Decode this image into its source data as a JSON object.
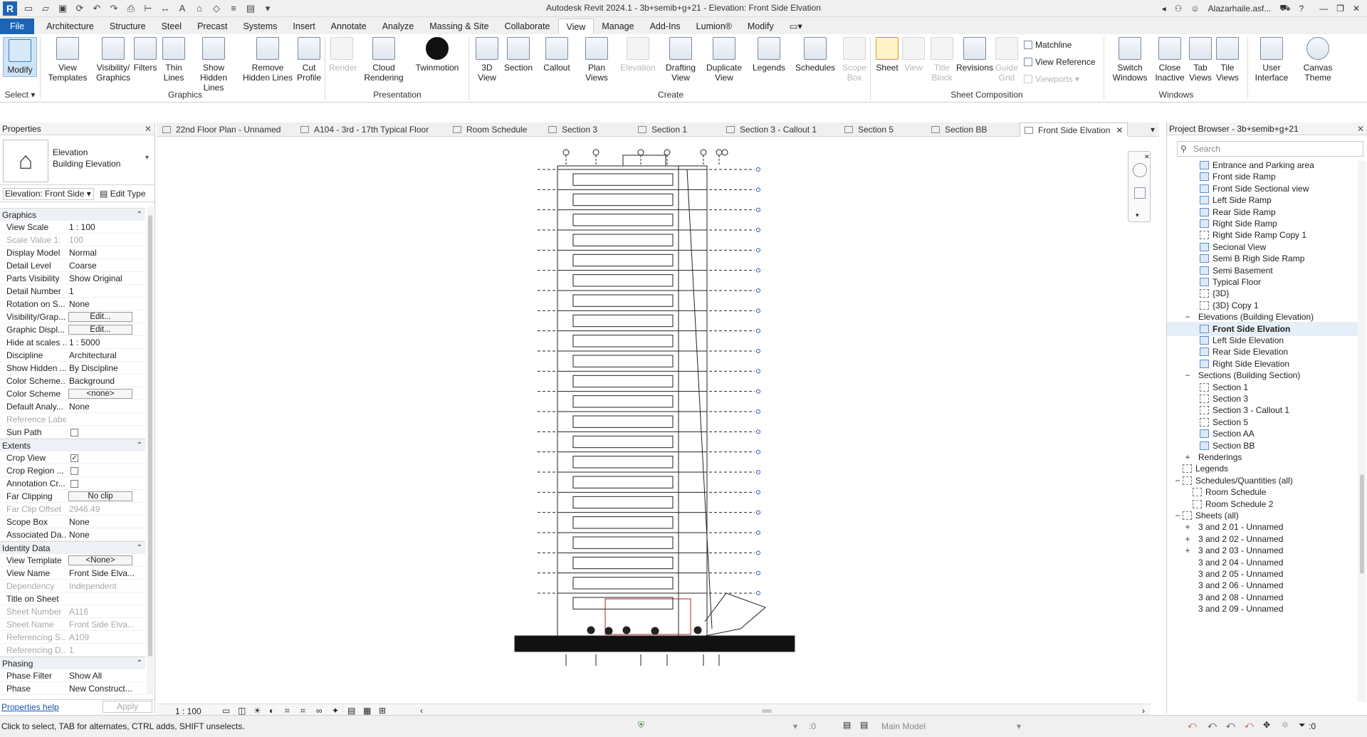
{
  "app": {
    "title": "Autodesk Revit 2024.1 - 3b+semib+g+21 - Elevation: Front Side Elvation",
    "user": "Alazarhaile.asf..."
  },
  "ribbon_tabs": [
    "File",
    "Architecture",
    "Structure",
    "Steel",
    "Precast",
    "Systems",
    "Insert",
    "Annotate",
    "Analyze",
    "Massing & Site",
    "Collaborate",
    "View",
    "Manage",
    "Add-Ins",
    "Lumion®",
    "Modify"
  ],
  "ribbon": {
    "select": {
      "modify": "Modify",
      "label": "Select"
    },
    "graphics": {
      "label": "Graphics",
      "view_templates": "View Templates",
      "visibility_graphics": "Visibility/ Graphics",
      "filters": "Filters",
      "thin_lines": "Thin Lines",
      "show_hidden_lines": "Show Hidden Lines",
      "remove_hidden_lines": "Remove Hidden Lines",
      "cut_profile": "Cut Profile"
    },
    "presentation": {
      "label": "Presentation",
      "render": "Render",
      "cloud_rendering": "Cloud Rendering",
      "twinmotion": "Twinmotion"
    },
    "create": {
      "label": "Create",
      "view_3d": "3D View",
      "section": "Section",
      "callout": "Callout",
      "plan_views": "Plan Views",
      "elevation": "Elevation",
      "drafting_view": "Drafting View",
      "duplicate_view": "Duplicate View",
      "legends": "Legends",
      "schedules": "Schedules",
      "scope_box": "Scope Box"
    },
    "sheet_composition": {
      "label": "Sheet Composition",
      "sheet": "Sheet",
      "view": "View",
      "title_block": "Title Block",
      "revisions": "Revisions",
      "guide_grid": "Guide Grid",
      "matchline": "Matchline",
      "view_reference": "View Reference",
      "viewports": "Viewports"
    },
    "windows": {
      "label": "Windows",
      "switch_windows": "Switch Windows",
      "close_inactive": "Close Inactive",
      "tab_views": "Tab Views",
      "tile_views": "Tile Views"
    },
    "ui": {
      "user_interface": "User Interface",
      "canvas_theme": "Canvas Theme"
    }
  },
  "properties": {
    "title": "Properties",
    "type_line1": "Elevation",
    "type_line2": "Building Elevation",
    "instance": "Elevation: Front Side",
    "edit_type": "Edit Type",
    "help": "Properties help",
    "apply": "Apply",
    "sections": {
      "graphics": "Graphics",
      "extents": "Extents",
      "identity": "Identity Data",
      "phasing": "Phasing"
    },
    "graphics_rows": [
      {
        "name": "View Scale",
        "value": "1 : 100"
      },
      {
        "name": "Scale Value    1:",
        "value": "100",
        "grey": true
      },
      {
        "name": "Display Model",
        "value": "Normal"
      },
      {
        "name": "Detail Level",
        "value": "Coarse"
      },
      {
        "name": "Parts Visibility",
        "value": "Show Original"
      },
      {
        "name": "Detail Number",
        "value": "1"
      },
      {
        "name": "Rotation on S...",
        "value": "None"
      },
      {
        "name": "Visibility/Grap...",
        "button": "Edit..."
      },
      {
        "name": "Graphic Displ...",
        "button": "Edit..."
      },
      {
        "name": "Hide at scales ...",
        "value": "1 : 5000"
      },
      {
        "name": "Discipline",
        "value": "Architectural"
      },
      {
        "name": "Show Hidden ...",
        "value": "By Discipline"
      },
      {
        "name": "Color Scheme...",
        "value": "Background"
      },
      {
        "name": "Color Scheme",
        "button": "<none>"
      },
      {
        "name": "Default Analy...",
        "value": "None"
      },
      {
        "name": "Reference Label",
        "value": "",
        "grey": true
      },
      {
        "name": "Sun Path",
        "check": false
      }
    ],
    "extents_rows": [
      {
        "name": "Crop View",
        "check": true
      },
      {
        "name": "Crop Region ...",
        "check": false
      },
      {
        "name": "Annotation Cr...",
        "check": false
      },
      {
        "name": "Far Clipping",
        "button": "No clip"
      },
      {
        "name": "Far Clip Offset",
        "value": "2946.49",
        "grey": true
      },
      {
        "name": "Scope Box",
        "value": "None"
      },
      {
        "name": "Associated Da...",
        "value": "None"
      }
    ],
    "identity_rows": [
      {
        "name": "View Template",
        "button": "<None>"
      },
      {
        "name": "View Name",
        "value": "Front Side Elva..."
      },
      {
        "name": "Dependency",
        "value": "Independent",
        "grey": true
      },
      {
        "name": "Title on Sheet",
        "value": ""
      },
      {
        "name": "Sheet Number",
        "value": "A116",
        "grey": true
      },
      {
        "name": "Sheet Name",
        "value": "Front Side Elva...",
        "grey": true
      },
      {
        "name": "Referencing S...",
        "value": "A109",
        "grey": true
      },
      {
        "name": "Referencing D...",
        "value": "1",
        "grey": true
      }
    ],
    "phasing_rows": [
      {
        "name": "Phase Filter",
        "value": "Show All"
      },
      {
        "name": "Phase",
        "value": "New Construct..."
      }
    ]
  },
  "view_tabs": [
    {
      "label": "22nd Floor Plan - Unnamed"
    },
    {
      "label": "A104 - 3rd - 17th Typical Floor"
    },
    {
      "label": "Room Schedule"
    },
    {
      "label": "Section 3"
    },
    {
      "label": "Section 1"
    },
    {
      "label": "Section 3 - Callout 1"
    },
    {
      "label": "Section 5"
    },
    {
      "label": "Section BB"
    },
    {
      "label": "Front Side Elvation",
      "active": true
    }
  ],
  "view_control": {
    "scale": "1 : 100"
  },
  "browser": {
    "title": "Project Browser - 3b+semib+g+21",
    "search_placeholder": "Search",
    "items": [
      {
        "label": "Entrance and Parking area",
        "level": 2
      },
      {
        "label": "Front side Ramp",
        "level": 2
      },
      {
        "label": "Front Side Sectional view",
        "level": 2
      },
      {
        "label": "Left Side Ramp",
        "level": 2
      },
      {
        "label": "Rear Side Ramp",
        "level": 2
      },
      {
        "label": "Right Side Ramp",
        "level": 2
      },
      {
        "label": "Right Side Ramp Copy 1",
        "level": 2,
        "plain": true
      },
      {
        "label": "Secional View",
        "level": 2
      },
      {
        "label": "Semi B Righ Side Ramp",
        "level": 2
      },
      {
        "label": "Semi Basement",
        "level": 2
      },
      {
        "label": "Typical Floor",
        "level": 2
      },
      {
        "label": "{3D}",
        "level": 2,
        "plain": true
      },
      {
        "label": "{3D} Copy 1",
        "level": 2,
        "plain": true
      },
      {
        "label": "Elevations (Building Elevation)",
        "level": 1,
        "toggle": "−"
      },
      {
        "label": "Front Side Elvation",
        "level": 2,
        "selected": true
      },
      {
        "label": "Left Side Elevation",
        "level": 2
      },
      {
        "label": "Rear Side Elevation",
        "level": 2
      },
      {
        "label": "Right Side Elevation",
        "level": 2
      },
      {
        "label": "Sections (Building Section)",
        "level": 1,
        "toggle": "−"
      },
      {
        "label": "Section 1",
        "level": 2,
        "plain": true
      },
      {
        "label": "Section 3",
        "level": 2,
        "plain": true
      },
      {
        "label": "Section 3 - Callout 1",
        "level": 2,
        "plain": true
      },
      {
        "label": "Section 5",
        "level": 2,
        "plain": true
      },
      {
        "label": "Section AA",
        "level": 2
      },
      {
        "label": "Section BB",
        "level": 2
      },
      {
        "label": "Renderings",
        "level": 1,
        "toggle": "+"
      },
      {
        "label": "Legends",
        "level": 0,
        "icon": true
      },
      {
        "label": "Schedules/Quantities (all)",
        "level": 0,
        "toggle": "−",
        "icon": true
      },
      {
        "label": "Room Schedule",
        "level": 1,
        "icon": true
      },
      {
        "label": "Room Schedule 2",
        "level": 1,
        "icon": true
      },
      {
        "label": "Sheets (all)",
        "level": 0,
        "toggle": "−",
        "icon": true
      },
      {
        "label": "3 and 2 01 - Unnamed",
        "level": 1,
        "toggle": "+"
      },
      {
        "label": "3 and 2 02 - Unnamed",
        "level": 1,
        "toggle": "+"
      },
      {
        "label": "3 and 2 03 - Unnamed",
        "level": 1,
        "toggle": "+"
      },
      {
        "label": "3 and 2 04 - Unnamed",
        "level": 1
      },
      {
        "label": "3 and 2 05 - Unnamed",
        "level": 1
      },
      {
        "label": "3 and 2 06 - Unnamed",
        "level": 1
      },
      {
        "label": "3 and 2 08 - Unnamed",
        "level": 1
      },
      {
        "label": "3 and 2 09 - Unnamed",
        "level": 1
      }
    ]
  },
  "status": {
    "hint": "Click to select, TAB for alternates, CTRL adds, SHIFT unselects.",
    "workset": ":0",
    "model": "Main Model",
    "filter_count": ":0"
  }
}
